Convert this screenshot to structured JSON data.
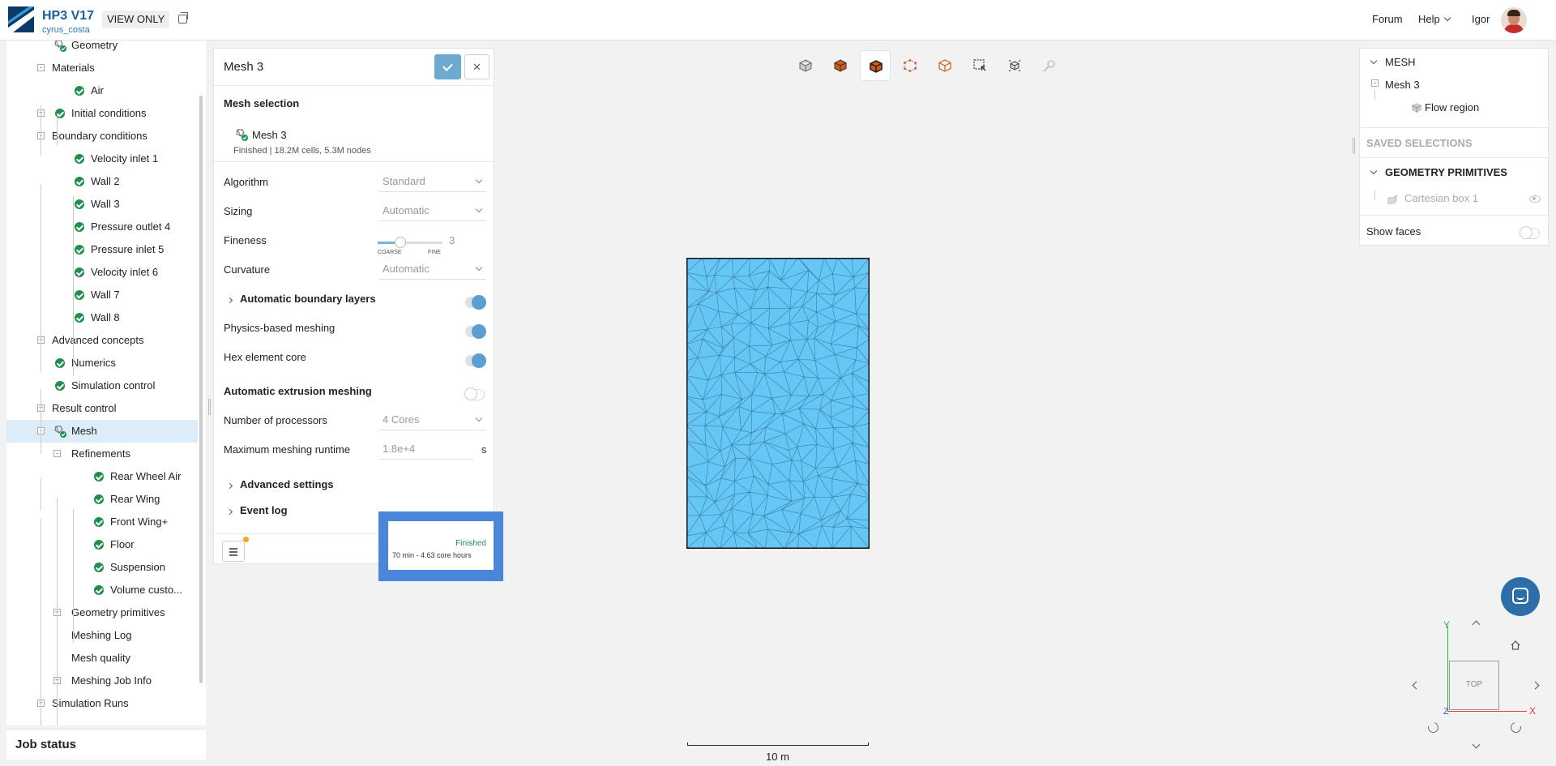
{
  "header": {
    "project_title": "HP3 V17",
    "project_owner": "cyrus_costa",
    "view_only_badge": "VIEW ONLY",
    "nav": {
      "forum": "Forum",
      "help": "Help",
      "user": "Igor"
    }
  },
  "tree": {
    "items": [
      {
        "label": "Geometry",
        "depth": 1,
        "icon": "mesh-check-icon"
      },
      {
        "label": "Materials",
        "depth": 0,
        "expander": "-"
      },
      {
        "label": "Air",
        "depth": 2,
        "icon": "check-icon"
      },
      {
        "label": "Initial conditions",
        "depth": 1,
        "icon": "check-icon",
        "expander": "+"
      },
      {
        "label": "Boundary conditions",
        "depth": 0,
        "expander": "-"
      },
      {
        "label": "Velocity inlet 1",
        "depth": 2,
        "icon": "check-icon"
      },
      {
        "label": "Wall 2",
        "depth": 2,
        "icon": "check-icon"
      },
      {
        "label": "Wall 3",
        "depth": 2,
        "icon": "check-icon"
      },
      {
        "label": "Pressure outlet 4",
        "depth": 2,
        "icon": "check-icon"
      },
      {
        "label": "Pressure inlet 5",
        "depth": 2,
        "icon": "check-icon"
      },
      {
        "label": "Velocity inlet 6",
        "depth": 2,
        "icon": "check-icon"
      },
      {
        "label": "Wall 7",
        "depth": 2,
        "icon": "check-icon"
      },
      {
        "label": "Wall 8",
        "depth": 2,
        "icon": "check-icon"
      },
      {
        "label": "Advanced concepts",
        "depth": 0,
        "expander": "+"
      },
      {
        "label": "Numerics",
        "depth": 1,
        "icon": "check-icon"
      },
      {
        "label": "Simulation control",
        "depth": 1,
        "icon": "check-icon"
      },
      {
        "label": "Result control",
        "depth": 0,
        "expander": "+"
      },
      {
        "label": "Mesh",
        "depth": 1,
        "icon": "mesh-check-icon",
        "expander": "-",
        "selected": true
      },
      {
        "label": "Refinements",
        "depth": 1,
        "expander": "-"
      },
      {
        "label": "Rear Wheel Air",
        "depth": 3,
        "icon": "check-icon"
      },
      {
        "label": "Rear Wing",
        "depth": 3,
        "icon": "check-icon"
      },
      {
        "label": "Front Wing+",
        "depth": 3,
        "icon": "check-icon"
      },
      {
        "label": "Floor",
        "depth": 3,
        "icon": "check-icon"
      },
      {
        "label": "Suspension",
        "depth": 3,
        "icon": "check-icon"
      },
      {
        "label": "Volume custo...",
        "depth": 3,
        "icon": "check-icon"
      },
      {
        "label": "Geometry primitives",
        "depth": 1,
        "expander": "+"
      },
      {
        "label": "Meshing Log",
        "depth": 1
      },
      {
        "label": "Mesh quality",
        "depth": 1
      },
      {
        "label": "Meshing Job Info",
        "depth": 1,
        "expander": "+"
      },
      {
        "label": "Simulation Runs",
        "depth": 0,
        "expander": "+"
      }
    ]
  },
  "job_status": {
    "title": "Job status"
  },
  "mesh_panel": {
    "title": "Mesh 3",
    "mesh_selection": {
      "title": "Mesh selection",
      "name": "Mesh 3",
      "info": "Finished | 18.2M cells, 5.3M nodes"
    },
    "algorithm": {
      "label": "Algorithm",
      "value": "Standard"
    },
    "sizing": {
      "label": "Sizing",
      "value": "Automatic"
    },
    "fineness": {
      "label": "Fineness",
      "value": "3",
      "min_label": "COARSE",
      "max_label": "FINE",
      "level_fraction": 0.2
    },
    "curvature": {
      "label": "Curvature",
      "value": "Automatic"
    },
    "auto_boundary_layers": {
      "label": "Automatic boundary layers",
      "on": true
    },
    "physics_meshing": {
      "label": "Physics-based meshing",
      "on": true
    },
    "hex_core": {
      "label": "Hex element core",
      "on": true
    },
    "auto_extrusion": {
      "label": "Automatic extrusion meshing",
      "on": false
    },
    "processors": {
      "label": "Number of processors",
      "value": "4 Cores"
    },
    "max_runtime": {
      "label": "Maximum meshing runtime",
      "value": "1.8e+4",
      "unit": "s"
    },
    "advanced_settings": {
      "label": "Advanced settings"
    },
    "event_log": {
      "label": "Event log"
    }
  },
  "job_card": {
    "status": "Finished",
    "details": "70 min - 4.63 core hours"
  },
  "viewport": {
    "toolbar": [
      "cube-view-icon",
      "solid-cube-icon",
      "solid-edges-cube-icon",
      "points-cube-icon",
      "wireframe-cube-icon",
      "box-select-icon",
      "explode-icon",
      "probe-icon"
    ],
    "scale_label": "10 m",
    "navcube_face": "TOP",
    "axes": {
      "x": "X",
      "y": "Y",
      "z": "Z"
    },
    "mesh_fill": "#66c6f5"
  },
  "right_panel": {
    "mesh_header": "MESH",
    "mesh_item": "Mesh 3",
    "flow_region": "Flow region",
    "saved_selections": "SAVED SELECTIONS",
    "geometry_primitives": "GEOMETRY PRIMITIVES",
    "cartesian_box": "Cartesian box 1",
    "show_faces": "Show faces"
  },
  "colors": {
    "accent": "#5b9fd0",
    "success": "#1e8f4e",
    "highlight_border": "#4a86d9",
    "brand": "#1a5f9e"
  }
}
